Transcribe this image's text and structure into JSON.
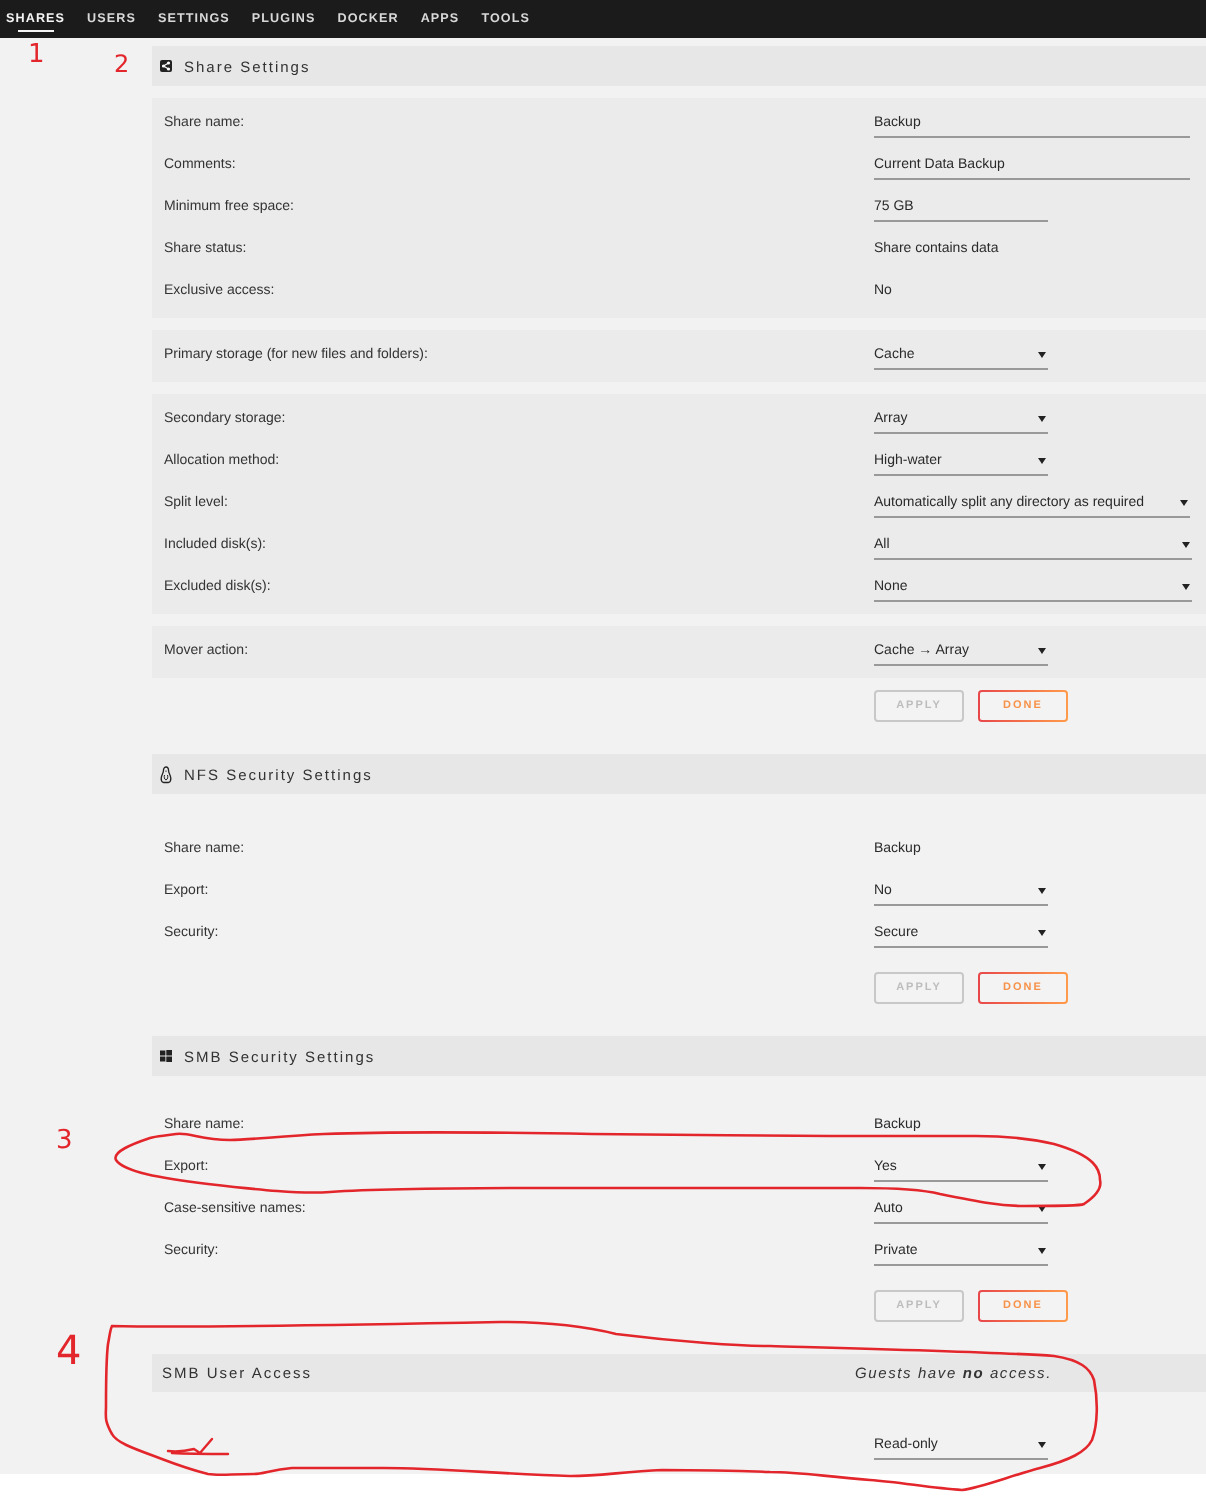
{
  "nav": [
    {
      "label": "SHARES",
      "selected": true
    },
    {
      "label": "USERS",
      "selected": false
    },
    {
      "label": "SETTINGS",
      "selected": false
    },
    {
      "label": "PLUGINS",
      "selected": false
    },
    {
      "label": "DOCKER",
      "selected": false
    },
    {
      "label": "APPS",
      "selected": false
    },
    {
      "label": "TOOLS",
      "selected": false
    }
  ],
  "share_settings": {
    "title": "Share Settings",
    "groups": [
      {
        "rows": [
          {
            "label": "Share name:",
            "kind": "text-input",
            "value": "Backup"
          },
          {
            "label": "Comments:",
            "kind": "text-input",
            "value": "Current Data Backup"
          },
          {
            "label": "Minimum free space:",
            "kind": "size-input",
            "value": "75 GB"
          },
          {
            "label": "Share status:",
            "kind": "static",
            "value": "Share contains data"
          },
          {
            "label": "Exclusive access:",
            "kind": "static",
            "value": "No"
          }
        ]
      },
      {
        "rows": [
          {
            "label": "Primary storage (for new files and folders):",
            "kind": "select",
            "value": "Cache"
          }
        ]
      },
      {
        "rows": [
          {
            "label": "Secondary storage:",
            "kind": "select",
            "value": "Array"
          },
          {
            "label": "Allocation method:",
            "kind": "select",
            "value": "High-water"
          },
          {
            "label": "Split level:",
            "kind": "select",
            "value": "Automatically split any directory as required"
          },
          {
            "label": "Included disk(s):",
            "kind": "multi-select",
            "value": "All"
          },
          {
            "label": "Excluded disk(s):",
            "kind": "multi-select",
            "value": "None"
          }
        ]
      },
      {
        "rows": [
          {
            "label": "Mover action:",
            "kind": "select",
            "value": "Cache → Array"
          }
        ]
      }
    ],
    "buttons": [
      {
        "label": "APPLY",
        "disabled": true
      },
      {
        "label": "DONE",
        "disabled": false
      }
    ]
  },
  "nfs_security": {
    "title": "NFS Security Settings",
    "rows": [
      {
        "label": "Share name:",
        "kind": "static",
        "value": "Backup"
      },
      {
        "label": "Export:",
        "kind": "select",
        "value": "No"
      },
      {
        "label": "Security:",
        "kind": "select",
        "value": "Secure"
      }
    ],
    "buttons": [
      {
        "label": "APPLY",
        "disabled": true
      },
      {
        "label": "DONE",
        "disabled": false
      }
    ]
  },
  "smb_security": {
    "title": "SMB Security Settings",
    "rows": [
      {
        "label": "Share name:",
        "kind": "static",
        "value": "Backup"
      },
      {
        "label": "Export:",
        "kind": "select",
        "value": "Yes"
      },
      {
        "label": "Case-sensitive names:",
        "kind": "select",
        "value": "Auto"
      },
      {
        "label": "Security:",
        "kind": "select",
        "value": "Private"
      }
    ],
    "buttons": [
      {
        "label": "APPLY",
        "disabled": true
      },
      {
        "label": "DONE",
        "disabled": false
      }
    ]
  },
  "smb_user_access": {
    "title": "SMB User Access",
    "note": "Guests have **no** access.",
    "rows": [
      {
        "kind": "select",
        "value": "Read-only",
        "redacted": true
      }
    ]
  },
  "annotations": [
    {
      "label": "1",
      "kind": "number"
    },
    {
      "label": "2",
      "kind": "number"
    },
    {
      "label": "3",
      "kind": "circled"
    },
    {
      "label": "4",
      "kind": "circled"
    }
  ]
}
